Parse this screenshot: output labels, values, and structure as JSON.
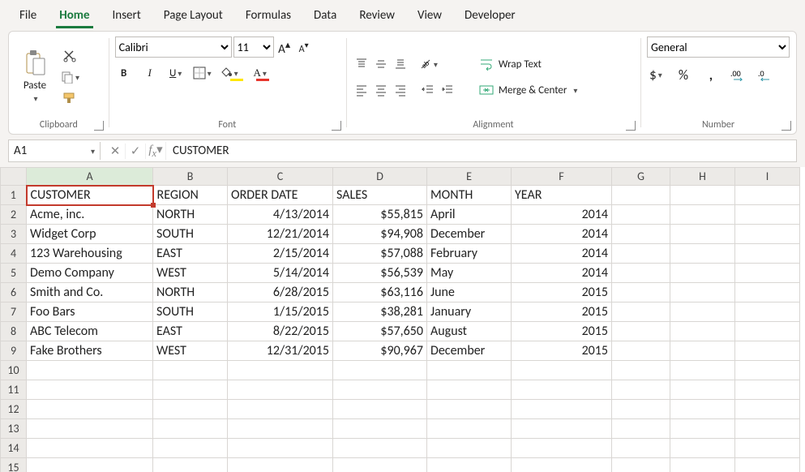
{
  "menu": {
    "items": [
      "File",
      "Home",
      "Insert",
      "Page Layout",
      "Formulas",
      "Data",
      "Review",
      "View",
      "Developer"
    ],
    "active": 1
  },
  "ribbon": {
    "clipboard": {
      "paste": "Paste",
      "label": "Clipboard"
    },
    "font": {
      "family": "Calibri",
      "size": "11",
      "label": "Font"
    },
    "alignment": {
      "wrap": "Wrap Text",
      "merge": "Merge & Center",
      "label": "Alignment"
    },
    "number": {
      "format": "General",
      "label": "Number"
    }
  },
  "formula": {
    "ref": "A1",
    "value": "CUSTOMER"
  },
  "columns": [
    "A",
    "B",
    "C",
    "D",
    "E",
    "F",
    "G",
    "H",
    "I"
  ],
  "headers": [
    "CUSTOMER",
    "REGION",
    "ORDER DATE",
    "SALES",
    "MONTH",
    "YEAR"
  ],
  "rows": [
    {
      "customer": "Acme, inc.",
      "region": "NORTH",
      "order_date": "4/13/2014",
      "sales": "$55,815",
      "month": "April",
      "year": "2014"
    },
    {
      "customer": "Widget Corp",
      "region": "SOUTH",
      "order_date": "12/21/2014",
      "sales": "$94,908",
      "month": "December",
      "year": "2014"
    },
    {
      "customer": "123 Warehousing",
      "region": "EAST",
      "order_date": "2/15/2014",
      "sales": "$57,088",
      "month": "February",
      "year": "2014"
    },
    {
      "customer": "Demo Company",
      "region": "WEST",
      "order_date": "5/14/2014",
      "sales": "$56,539",
      "month": "May",
      "year": "2014"
    },
    {
      "customer": "Smith and Co.",
      "region": "NORTH",
      "order_date": "6/28/2015",
      "sales": "$63,116",
      "month": "June",
      "year": "2015"
    },
    {
      "customer": "Foo Bars",
      "region": "SOUTH",
      "order_date": "1/15/2015",
      "sales": "$38,281",
      "month": "January",
      "year": "2015"
    },
    {
      "customer": "ABC Telecom",
      "region": "EAST",
      "order_date": "8/22/2015",
      "sales": "$57,650",
      "month": "August",
      "year": "2015"
    },
    {
      "customer": "Fake Brothers",
      "region": "WEST",
      "order_date": "12/31/2015",
      "sales": "$90,967",
      "month": "December",
      "year": "2015"
    }
  ],
  "blank_rows": [
    10,
    11,
    12,
    13,
    14,
    15
  ],
  "icons": {
    "percent": "%",
    "comma": ",",
    "dollar": "$"
  }
}
